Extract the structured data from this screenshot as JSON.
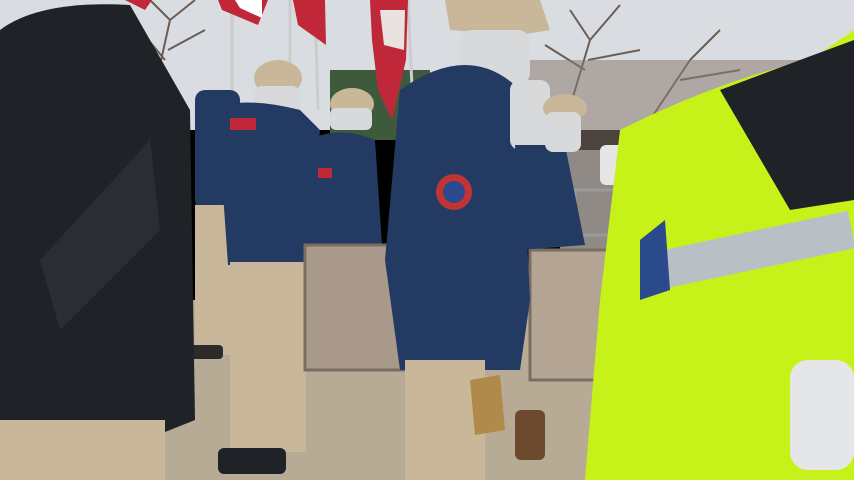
{
  "scene": {
    "kind": "photograph",
    "subject": "outdoor-crowd-scene",
    "colors": {
      "sky": "#d9dde2",
      "ground": "#b8ab96",
      "navy_jacket": "#233a63",
      "khaki": "#c9b79a",
      "hi_vis": "#c6f21a",
      "reflective": "#b9bfc4",
      "shield": "#a8998a",
      "black_coat": "#1f2226",
      "flag_red": "#c0283a"
    },
    "patch_colors": {
      "ring": "#c23434",
      "center": "#2a4a8c"
    }
  }
}
